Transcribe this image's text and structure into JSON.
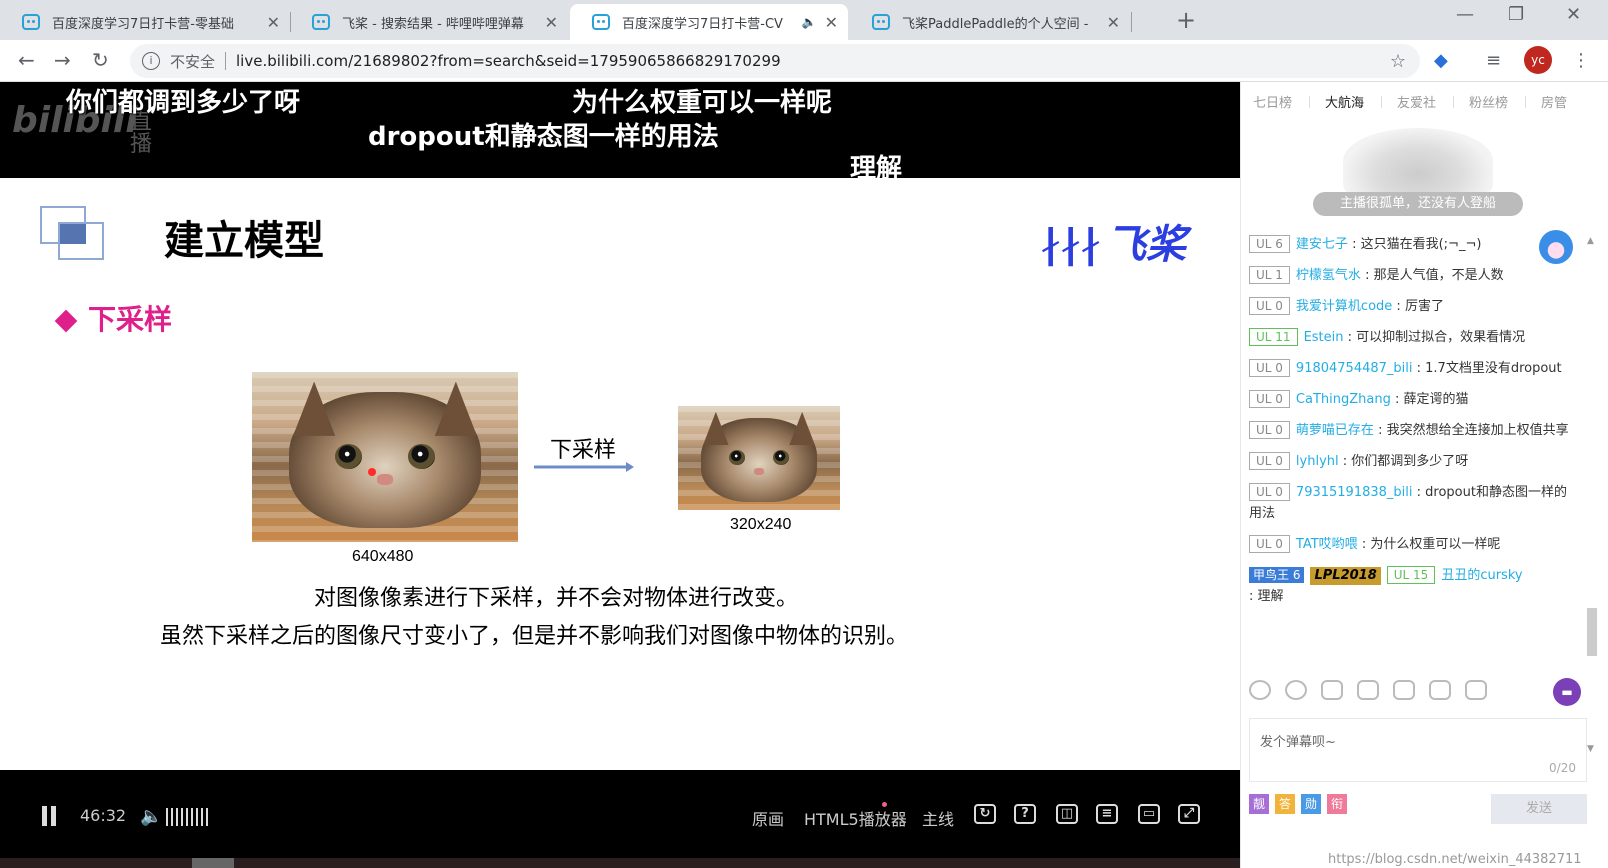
{
  "tabs": [
    {
      "title": "百度深度学习7日打卡营-零基础"
    },
    {
      "title": "飞桨 - 搜索结果 - 哔哩哔哩弹幕"
    },
    {
      "title": "百度深度学习7日打卡营-CV"
    },
    {
      "title": "飞桨PaddlePaddle的个人空间 -"
    }
  ],
  "address": {
    "security": "不安全",
    "url": "live.bilibili.com/21689802?from=search&seid=17959065866829170299"
  },
  "profile_initials": "yc",
  "danmaku": [
    "你们都调到多少了呀",
    "为什么权重可以一样呢",
    "dropout和静态图一样的用法",
    "理解"
  ],
  "watermark": {
    "logo": "bilibili",
    "text": "直播"
  },
  "slide": {
    "title": "建立模型",
    "logo": "飞桨",
    "subheading": "下采样",
    "arrow_label": "下采样",
    "big_size": "640x480",
    "small_size": "320x240",
    "line1": "对图像像素进行下采样，并不会对物体进行改变。",
    "line2": "虽然下采样之后的图像尺寸变小了，但是并不影响我们对图像中物体的识别。"
  },
  "player": {
    "time": "46:32",
    "quality": "原画",
    "player_type": "HTML5播放器",
    "line": "主线",
    "playback_fraction": 0.14
  },
  "panel": {
    "tabs": [
      "七日榜",
      "大航海",
      "友爱社",
      "粉丝榜",
      "房管"
    ],
    "empty_text": "主播很孤单，还没有人登船",
    "messages": [
      {
        "ul": "UL 6",
        "name": "建安七子",
        "text": "这只猫在看我(;¬_¬)"
      },
      {
        "ul": "UL 1",
        "name": "柠檬氢气水",
        "text": "那是人气值，不是人数"
      },
      {
        "ul": "UL 0",
        "name": "我爱计算机code",
        "text": "厉害了"
      },
      {
        "ul": "UL 11",
        "name": "Estein",
        "text": "可以抑制过拟合，效果看情况"
      },
      {
        "ul": "UL 0",
        "name": "91804754487_bili",
        "text": "1.7文档里没有dropout"
      },
      {
        "ul": "UL 0",
        "name": "CaThingZhang",
        "text": "薛定谔的猫"
      },
      {
        "ul": "UL 0",
        "name": "萌萝喵已存在",
        "text": "我突然想给全连接加上权值共享"
      },
      {
        "ul": "UL 0",
        "name": "lyhlyhl",
        "text": "你们都调到多少了呀"
      },
      {
        "ul": "UL 0",
        "name": "79315191838_bili",
        "text": "dropout和静态图一样的用法"
      },
      {
        "ul": "UL 0",
        "name": "TAT哎哟喂",
        "text": "为什么权重可以一样呢"
      }
    ],
    "last": {
      "medal": "甲鸟王",
      "medal_level": "6",
      "lpl": "LPL2018",
      "ul": "UL 15",
      "name": "丑丑的cursky",
      "text": "理解"
    },
    "input_placeholder": "发个弹幕呗~",
    "input_count": "0/20",
    "emoji": [
      "靓",
      "答",
      "勋",
      "衔"
    ],
    "send": "发送"
  },
  "page_watermark": "https://blog.csdn.net/weixin_44382711"
}
